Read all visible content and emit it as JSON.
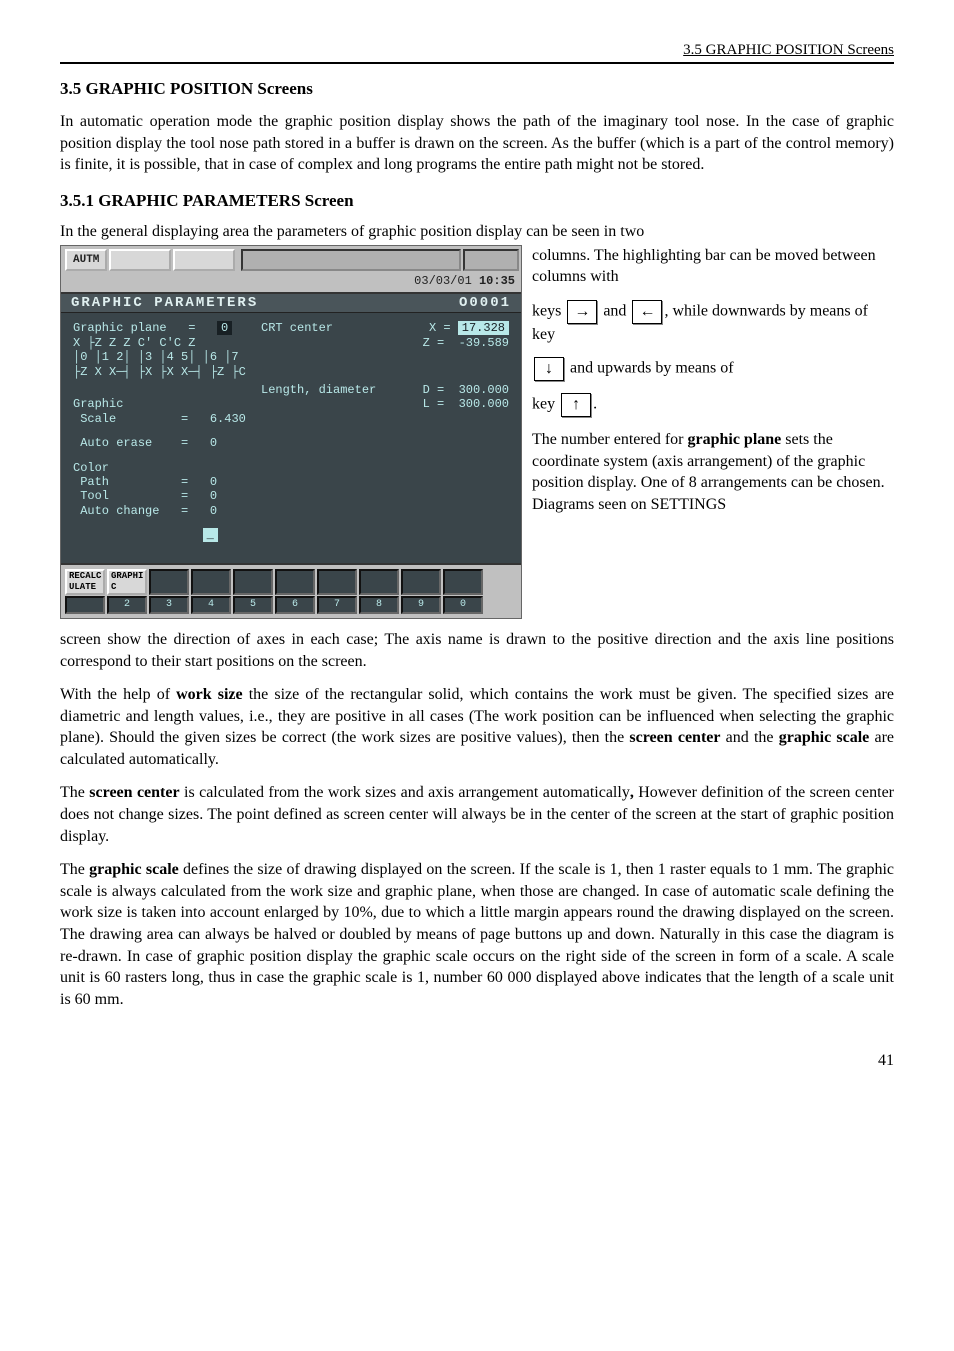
{
  "page": {
    "header_right": "3.5 GRAPHIC POSITION Screens",
    "h2": "3.5 GRAPHIC POSITION Screens",
    "intro": "In automatic operation mode the graphic position display shows the path of the imaginary tool nose. In the case of graphic position display the tool nose path stored in a buffer is drawn on the screen. As the buffer (which is a part of the control memory) is finite, it is possible, that in case of complex and long programs the entire path might not be stored.",
    "h3": "3.5.1 GRAPHIC PARAMETERS Screen",
    "lead": "In the general displaying area the parameters of graphic position display can be seen in two",
    "side": {
      "p1a": "columns. The highlighting bar can be moved between columns with",
      "p2a": "keys",
      "p2b": "and",
      "p2c": ", while downwards by means of key",
      "p3a": "and upwards by means of",
      "p4a": "key",
      "p4b": ".",
      "p5": "The number entered for ",
      "p5b": "graphic plane",
      "p5c": " sets the coordinate system (axis arrangement) of the graphic position display. One of 8 arrangements can be chosen. Diagrams seen on SETTINGS"
    },
    "after1": "screen show the direction of axes in each case; The axis name is drawn to the positive direction and the axis line positions correspond to their start positions on the screen.",
    "after2a": "With the help of ",
    "after2b": "work size",
    "after2c": " the size of the rectangular solid, which contains the work must be given. The specified sizes are diametric and length values, i.e., they are positive in all cases (The work position can be influenced when selecting the graphic plane).  Should the given sizes be correct (the work sizes are positive values), then the ",
    "after2d": "screen center",
    "after2e": " and the ",
    "after2f": "graphic scale",
    "after2g": " are calculated automatically.",
    "after3a": "The ",
    "after3b": "screen center",
    "after3c": " is calculated from the work sizes and axis arrangement automatically",
    "after3d": ", ",
    "after3e": "However definition of the screen center does not change sizes. The point defined as screen center will always be in the center of the screen at the start of graphic position display.",
    "after4a": "The ",
    "after4b": "graphic scale",
    "after4c": " defines the size of drawing displayed on the screen. If the scale is 1, then 1 raster equals to 1 mm. The graphic scale is always calculated from the work size and graphic plane, when those are changed. In case of automatic scale defining the work size is taken into account enlarged by 10%, due to which a little margin appears round the drawing displayed on the screen. The drawing area can always be halved or doubled by means of page buttons up and down. Naturally in this case the diagram is re-drawn. In case of graphic position display the graphic scale occurs on the right side of the screen in form of a scale. A scale unit is 60 rasters long, thus in case the graphic scale is 1, number 60 000 displayed above indicates that the length of a scale unit is 60 mm.",
    "pagenum": "41"
  },
  "screen": {
    "mode": "AUTM",
    "clock_date": "03/03/01",
    "clock_time": "10:35",
    "title_left": "GRAPHIC PARAMETERS",
    "title_right": "O0001",
    "graphic_plane_label": "Graphic plane",
    "graphic_plane_val": "0",
    "plane_row1": "X  ├Z  Z Z   C'   C'C   Z",
    "plane_row2": "│0  │1  2│ │3  │4  5│ │6  │7",
    "plane_row3": "├Z X  X─┤ ├X ├X X─┤ ├Z ├C",
    "crt_center_label": "CRT center",
    "crt_x_label": "X =",
    "crt_x_val": "17.328",
    "crt_z_label": "Z =",
    "crt_z_val": "-39.589",
    "len_dia_label": "Length, diameter",
    "len_d_label": "D =",
    "len_d_val": "300.000",
    "len_l_label": "L =",
    "len_l_val": "300.000",
    "graphic_label": "Graphic",
    "scale_label": "Scale",
    "scale_val": "6.430",
    "auto_erase_label": "Auto erase",
    "auto_erase_val": "0",
    "color_label": "Color",
    "path_label": "Path",
    "path_val": "0",
    "tool_label": "Tool",
    "tool_val": "0",
    "auto_change_label": "Auto change",
    "auto_change_val": "0",
    "dash": "_",
    "soft": {
      "k1a": "RECALC",
      "k1b": "ULATE",
      "k2a": "GRAPHI",
      "k2b": "C",
      "n2": "2",
      "n3": "3",
      "n4": "4",
      "n5": "5",
      "n6": "6",
      "n7": "7",
      "n8": "8",
      "n9": "9",
      "n0": "0"
    }
  }
}
